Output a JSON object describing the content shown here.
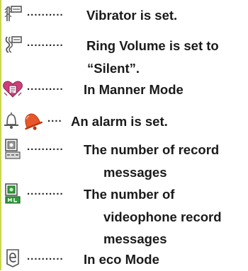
{
  "legend": {
    "entries": [
      {
        "icon": "vibrator-icon",
        "leader": "..........",
        "lines": [
          "Vibrator is set."
        ]
      },
      {
        "icon": "ring-volume-silent-icon",
        "leader": "..........",
        "lines": [
          "Ring Volume is set to",
          "“Silent”."
        ]
      },
      {
        "icon": "manner-mode-icon",
        "leader": "..........",
        "lines": [
          "In Manner Mode"
        ]
      },
      {
        "icon": "alarm-bell-icon",
        "leader": "....",
        "lines": [
          "An alarm is set."
        ]
      },
      {
        "icon": "record-message-icon",
        "leader": "..........",
        "lines": [
          "The number of record",
          "messages"
        ]
      },
      {
        "icon": "videophone-record-icon",
        "leader": "..........",
        "lines": [
          "The number of",
          "videophone record",
          "messages"
        ]
      },
      {
        "icon": "eco-mode-icon",
        "leader": "..........",
        "lines": [
          "In eco Mode"
        ]
      }
    ]
  },
  "colors": {
    "text": "#1a1a1a",
    "accent_bar": "#c9d84e",
    "manner_pink": "#cc3f7a",
    "alarm_orange": "#e8572a",
    "record_green": "#2f9e3a"
  }
}
